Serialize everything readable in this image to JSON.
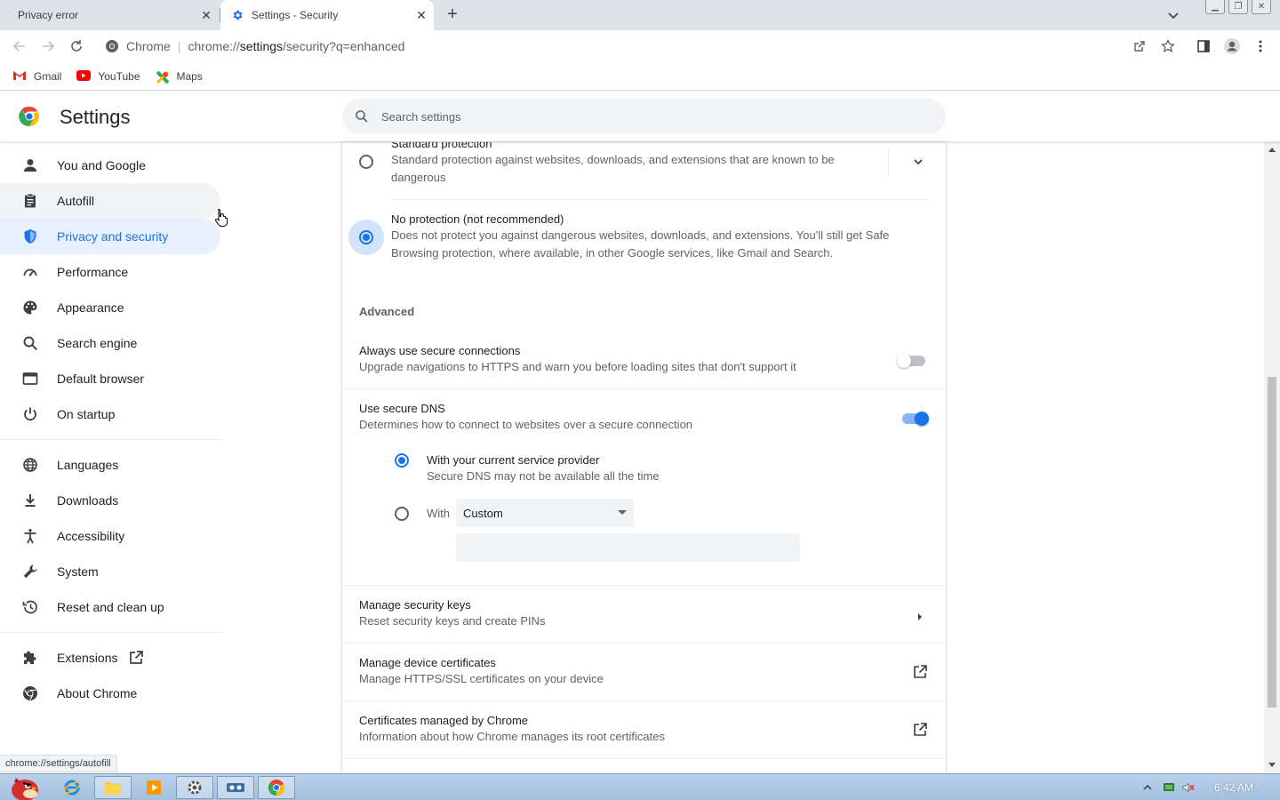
{
  "browser": {
    "tabs": [
      {
        "title": "Privacy error",
        "active": false
      },
      {
        "title": "Settings - Security",
        "active": true
      }
    ],
    "omnibox": {
      "site_label": "Chrome",
      "url_prefix": "chrome://",
      "url_host": "settings",
      "url_rest": "/security?q=enhanced"
    },
    "bookmarks": [
      {
        "label": "Gmail",
        "icon": "gmail-icon"
      },
      {
        "label": "YouTube",
        "icon": "youtube-icon"
      },
      {
        "label": "Maps",
        "icon": "maps-icon"
      }
    ]
  },
  "settings": {
    "title": "Settings",
    "search_placeholder": "Search settings"
  },
  "sidebar": {
    "items": [
      {
        "label": "You and Google",
        "icon": "person-icon"
      },
      {
        "label": "Autofill",
        "icon": "clipboard-icon"
      },
      {
        "label": "Privacy and security",
        "icon": "shield-icon"
      },
      {
        "label": "Performance",
        "icon": "speedometer-icon"
      },
      {
        "label": "Appearance",
        "icon": "palette-icon"
      },
      {
        "label": "Search engine",
        "icon": "search-icon"
      },
      {
        "label": "Default browser",
        "icon": "browser-window-icon"
      },
      {
        "label": "On startup",
        "icon": "power-icon"
      },
      {
        "label": "Languages",
        "icon": "globe-icon"
      },
      {
        "label": "Downloads",
        "icon": "download-icon"
      },
      {
        "label": "Accessibility",
        "icon": "accessibility-icon"
      },
      {
        "label": "System",
        "icon": "wrench-icon"
      },
      {
        "label": "Reset and clean up",
        "icon": "history-icon"
      },
      {
        "label": "Extensions",
        "icon": "puzzle-icon"
      },
      {
        "label": "About Chrome",
        "icon": "chrome-logo-icon"
      }
    ],
    "selected": "Privacy and security",
    "hovered": "Autofill"
  },
  "main": {
    "standard_protection": {
      "title": "Standard protection",
      "description": "Standard protection against websites, downloads, and extensions that are known to be dangerous",
      "selected": false
    },
    "no_protection": {
      "title": "No protection (not recommended)",
      "description": "Does not protect you against dangerous websites, downloads, and extensions. You'll still get Safe Browsing protection, where available, in other Google services, like Gmail and Search.",
      "selected": true
    },
    "advanced_heading": "Advanced",
    "secure_connections": {
      "title": "Always use secure connections",
      "description": "Upgrade navigations to HTTPS and warn you before loading sites that don't support it",
      "enabled": false
    },
    "secure_dns": {
      "title": "Use secure DNS",
      "description": "Determines how to connect to websites over a secure connection",
      "enabled": true,
      "option_current": {
        "title": "With your current service provider",
        "description": "Secure DNS may not be available all the time",
        "selected": true
      },
      "option_with": {
        "label": "With",
        "selected": false,
        "provider_value": "Custom",
        "custom_input_value": ""
      }
    },
    "security_keys": {
      "title": "Manage security keys",
      "description": "Reset security keys and create PINs"
    },
    "device_certificates": {
      "title": "Manage device certificates",
      "description": "Manage HTTPS/SSL certificates on your device"
    },
    "chrome_certificates": {
      "title": "Certificates managed by Chrome",
      "description": "Information about how Chrome manages its root certificates"
    }
  },
  "status_bar": {
    "hover_url": "chrome://settings/autofill"
  },
  "taskbar": {
    "clock": "6:42 AM"
  },
  "colors": {
    "accent": "#1a73e8",
    "selected_bg": "#e8f0fe",
    "text_primary": "#202124",
    "text_secondary": "#5f6368"
  }
}
